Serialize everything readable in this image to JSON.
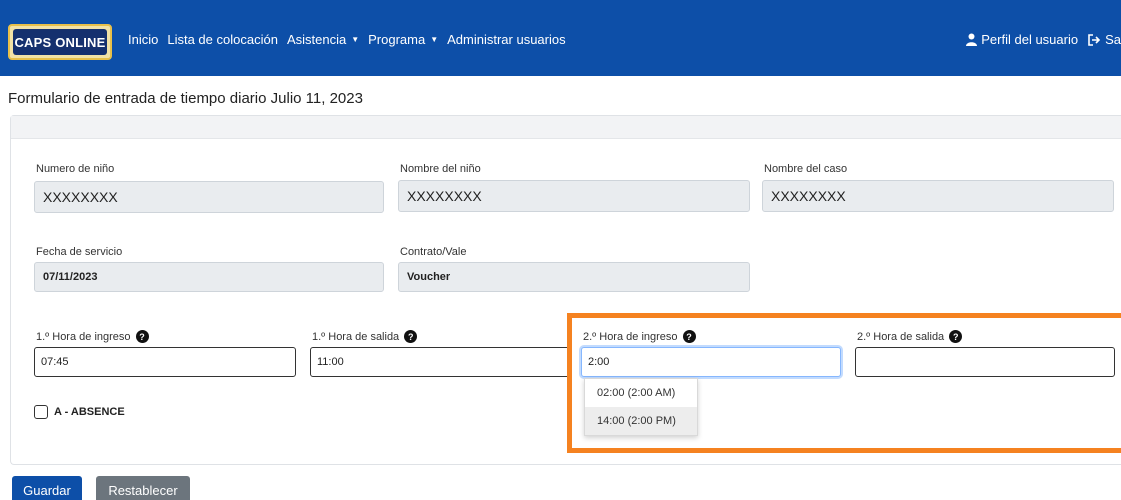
{
  "navbar": {
    "logo_text": "CAPS ONLINE",
    "links": [
      "Inicio",
      "Lista de colocación",
      "Asistencia",
      "Programa",
      "Administrar usuarios"
    ],
    "profile_label": "Perfil del usuario",
    "logout_label": "Sa",
    "icons": {
      "user": "user-icon",
      "logout": "sign-out-icon",
      "dropdown": "caret-down-icon"
    },
    "colors": {
      "background": "#0d4fa8"
    }
  },
  "page": {
    "title": "Formulario de entrada de tiempo diario  Julio 11, 2023"
  },
  "form": {
    "child_number": {
      "label": "Numero de niño",
      "value": "XXXXXXXX"
    },
    "child_name": {
      "label": "Nombre del niño",
      "value": "XXXXXXXX"
    },
    "case_name": {
      "label": "Nombre del caso",
      "value": "XXXXXXXX"
    },
    "service_date": {
      "label": "Fecha de servicio",
      "value": "07/11/2023"
    },
    "contract": {
      "label": "Contrato/Vale",
      "value": "Voucher"
    },
    "time_in_1": {
      "label": "1.º Hora de ingreso",
      "value": "07:45"
    },
    "time_out_1": {
      "label": "1.º Hora de salida",
      "value": "11:00"
    },
    "time_in_2": {
      "label": "2.º Hora de ingreso",
      "value": "2:00"
    },
    "time_out_2": {
      "label": "2.º Hora de salida",
      "value": ""
    },
    "help_icon": "?",
    "dropdown_options": [
      "02:00 (2:00 AM)",
      "14:00 (2:00 PM)"
    ],
    "absence_label": "A - ABSENCE"
  },
  "buttons": {
    "save": "Guardar",
    "reset": "Restablecer"
  },
  "colors": {
    "primary": "#0d4fa8",
    "secondary": "#6c757d",
    "highlight": "#f58220"
  }
}
